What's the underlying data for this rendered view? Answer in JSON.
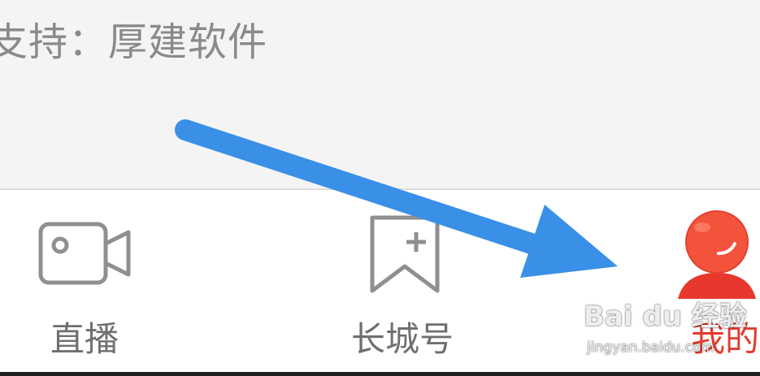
{
  "content": {
    "support_text": "支持：厚建软件"
  },
  "tabbar": {
    "tabs": [
      {
        "label": "直播",
        "icon": "video-camera-icon",
        "active": false
      },
      {
        "label": "长城号",
        "icon": "bookmark-plus-icon",
        "active": false
      },
      {
        "label": "我的",
        "icon": "user-avatar-icon",
        "active": true
      }
    ]
  },
  "annotation": {
    "arrow_icon": "blue-arrow-icon",
    "arrow_color": "#3a8fe6"
  },
  "watermark": {
    "main": "Bai du 经验",
    "sub": "jingyan.baidu.com"
  },
  "colors": {
    "background": "#f4f4f4",
    "tabbar": "#ffffff",
    "inactive_text": "#6f6f6f",
    "active_text": "#e23a2e",
    "avatar": "#f2533a"
  }
}
